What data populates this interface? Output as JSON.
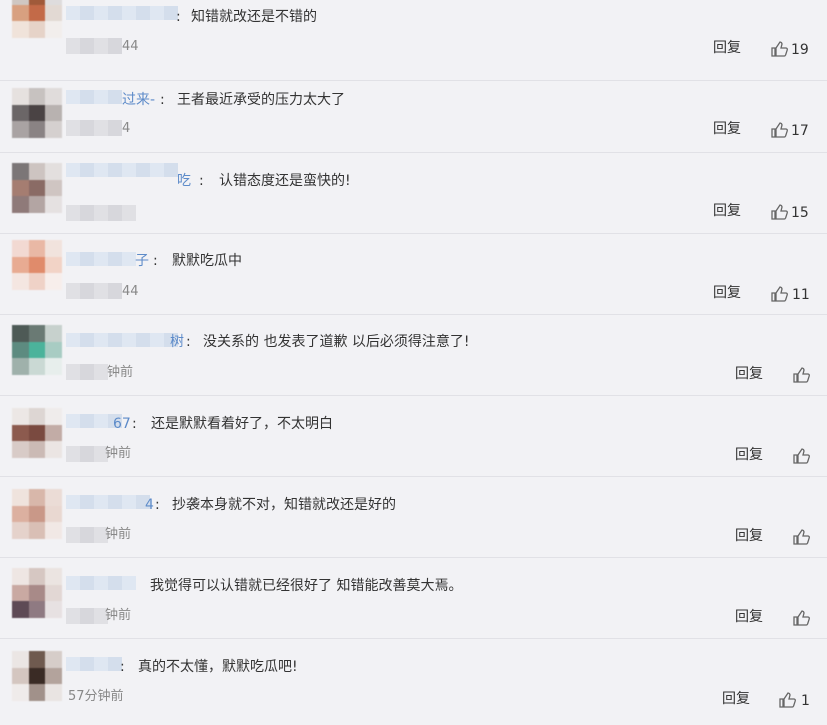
{
  "reply_label": "回复",
  "comments": [
    {
      "user_suffix": "",
      "text": "知错就改还是不错的",
      "time_fragment": "44",
      "likes": "19"
    },
    {
      "user_suffix": "过来-",
      "text": "王者最近承受的压力太大了",
      "time_fragment": "4",
      "likes": "17"
    },
    {
      "user_suffix": "吃",
      "text": "认错态度还是蛮快的!",
      "time_fragment": "",
      "likes": "15"
    },
    {
      "user_suffix": "子",
      "text": "默默吃瓜中",
      "time_fragment": "44",
      "likes": "11"
    },
    {
      "user_suffix": "树",
      "text": "没关系的 也发表了道歉 以后必须得注意了!",
      "time_fragment": "钟前",
      "likes": ""
    },
    {
      "user_suffix": "67",
      "text": "还是默默看着好了，不太明白",
      "time_fragment": "钟前",
      "likes": ""
    },
    {
      "user_suffix": "4",
      "text": "抄袭本身就不对，知错就改还是好的",
      "time_fragment": "钟前",
      "likes": ""
    },
    {
      "user_suffix": "",
      "text": "我觉得可以认错就已经很好了 知错能改善莫大焉。",
      "time_fragment": "钟前",
      "likes": ""
    },
    {
      "user_suffix": "",
      "text": "真的不太懂，默默吃瓜吧!",
      "time": "57分钟前",
      "likes": "1"
    }
  ],
  "colors": {
    "link": "#5d8bc9",
    "muted": "#888888",
    "background": "#f2f2f5"
  },
  "icons": {
    "like": "thumbs-up-icon"
  }
}
